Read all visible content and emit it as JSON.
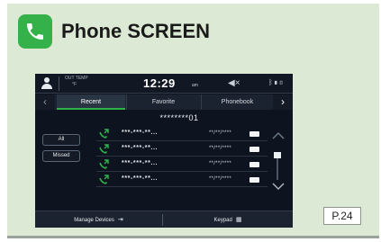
{
  "header": {
    "title": "Phone SCREEN",
    "icon": "phone-icon",
    "badge_color": "#35b14a"
  },
  "screen": {
    "statusbar": {
      "out_temp_label": "OUT TEMP",
      "out_temp_value": "°F",
      "time": "12:29",
      "ampm": "am",
      "mute_icon": "volume-mute-icon",
      "signal_icons": "bluetooth-signal-battery-icons"
    },
    "tabs": {
      "recent": "Recent",
      "favorite": "Favorite",
      "phonebook": "Phonebook"
    },
    "selected_number": "********01",
    "filters": {
      "all": "All",
      "missed": "Missed"
    },
    "calls": [
      {
        "number": "***-***-**...",
        "date": "**/**/****",
        "type": "outgoing"
      },
      {
        "number": "***-***-**...",
        "date": "**/**/****",
        "type": "outgoing"
      },
      {
        "number": "***-***-**...",
        "date": "**/**/****",
        "type": "outgoing"
      },
      {
        "number": "***-***-**...",
        "date": "**/**/****",
        "type": "outgoing"
      }
    ],
    "bottom": {
      "manage_devices": "Manage Devices",
      "keypad": "Keypad"
    },
    "accent_color": "#2fb14a"
  },
  "page_ref": "P.24"
}
